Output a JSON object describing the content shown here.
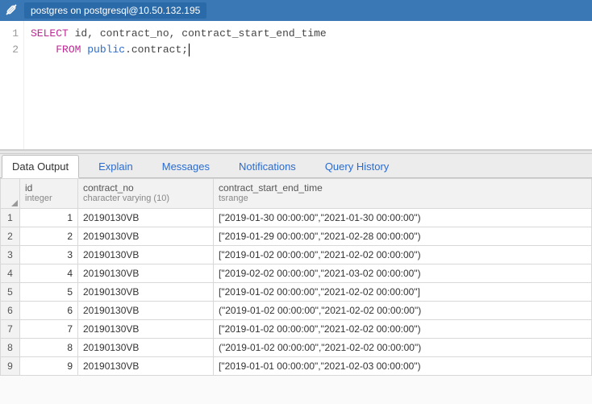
{
  "titlebar": {
    "connection": "postgres on postgresql@10.50.132.195"
  },
  "editor": {
    "lines": [
      {
        "num": "1",
        "tokens": [
          {
            "t": "SELECT",
            "c": "kw1"
          },
          {
            "t": " ",
            "c": "tok"
          },
          {
            "t": "id",
            "c": "tok"
          },
          {
            "t": ", ",
            "c": "tok"
          },
          {
            "t": "contract_no",
            "c": "tok"
          },
          {
            "t": ", ",
            "c": "tok"
          },
          {
            "t": "contract_start_end_time",
            "c": "tok"
          }
        ]
      },
      {
        "num": "2",
        "indent": "    ",
        "tokens": [
          {
            "t": "FROM",
            "c": "kw1"
          },
          {
            "t": " ",
            "c": "tok"
          },
          {
            "t": "public",
            "c": "kw2"
          },
          {
            "t": ".contract;",
            "c": "tok"
          }
        ],
        "caret": true
      }
    ]
  },
  "tabs": [
    {
      "label": "Data Output",
      "active": true
    },
    {
      "label": "Explain"
    },
    {
      "label": "Messages"
    },
    {
      "label": "Notifications"
    },
    {
      "label": "Query History"
    }
  ],
  "columns": [
    {
      "name": "id",
      "type": "integer"
    },
    {
      "name": "contract_no",
      "type": "character varying (10)"
    },
    {
      "name": "contract_start_end_time",
      "type": "tsrange"
    }
  ],
  "rows": [
    {
      "n": "1",
      "id": "1",
      "cno": "20190130VB",
      "r": "[\"2019-01-30 00:00:00\",\"2021-01-30 00:00:00\")"
    },
    {
      "n": "2",
      "id": "2",
      "cno": "20190130VB",
      "r": "[\"2019-01-29 00:00:00\",\"2021-02-28 00:00:00\")"
    },
    {
      "n": "3",
      "id": "3",
      "cno": "20190130VB",
      "r": "[\"2019-01-02 00:00:00\",\"2021-02-02 00:00:00\")"
    },
    {
      "n": "4",
      "id": "4",
      "cno": "20190130VB",
      "r": "[\"2019-02-02 00:00:00\",\"2021-03-02 00:00:00\")"
    },
    {
      "n": "5",
      "id": "5",
      "cno": "20190130VB",
      "r": "[\"2019-01-02 00:00:00\",\"2021-02-02 00:00:00\"]"
    },
    {
      "n": "6",
      "id": "6",
      "cno": "20190130VB",
      "r": "(\"2019-01-02 00:00:00\",\"2021-02-02 00:00:00\")"
    },
    {
      "n": "7",
      "id": "7",
      "cno": "20190130VB",
      "r": "[\"2019-01-02 00:00:00\",\"2021-02-02 00:00:00\")"
    },
    {
      "n": "8",
      "id": "8",
      "cno": "20190130VB",
      "r": "(\"2019-01-02 00:00:00\",\"2021-02-02 00:00:00\")"
    },
    {
      "n": "9",
      "id": "9",
      "cno": "20190130VB",
      "r": "[\"2019-01-01 00:00:00\",\"2021-02-03 00:00:00\")"
    }
  ]
}
